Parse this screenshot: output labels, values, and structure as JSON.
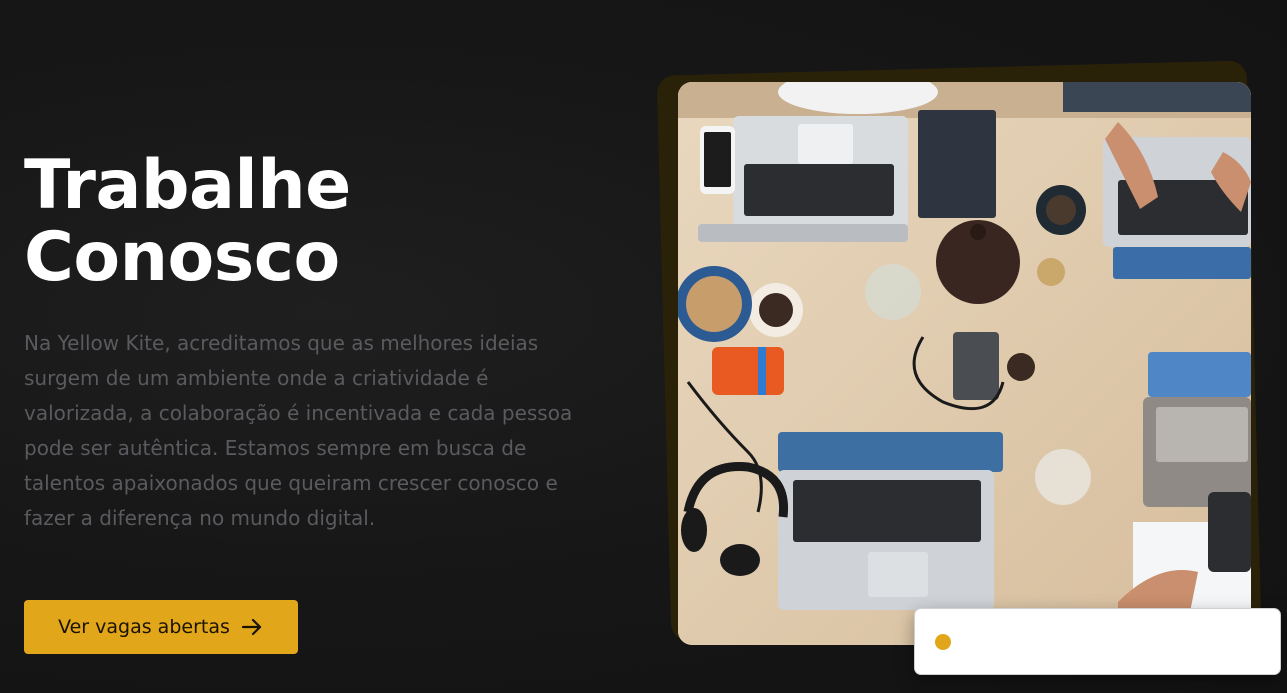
{
  "hero": {
    "title_line1": "Trabalhe",
    "title_line2": "Conosco",
    "description": "Na Yellow Kite, acreditamos que as melhores ideias surgem de um ambiente onde a criatividade é valorizada, a colaboração é incentivada e cada pessoa pode ser autêntica. Estamos sempre em busca de talentos apaixonados que queiram crescer conosco e fazer a diferença no mundo digital.",
    "cta_label": "Ver vagas abertas",
    "cta_icon": "arrow-right-icon"
  },
  "badge": {
    "text": "",
    "dot_color": "#e2a61a"
  },
  "colors": {
    "accent": "#e2a61a",
    "background": "#161616",
    "title": "#ffffff",
    "description": "#5a5a5f"
  }
}
